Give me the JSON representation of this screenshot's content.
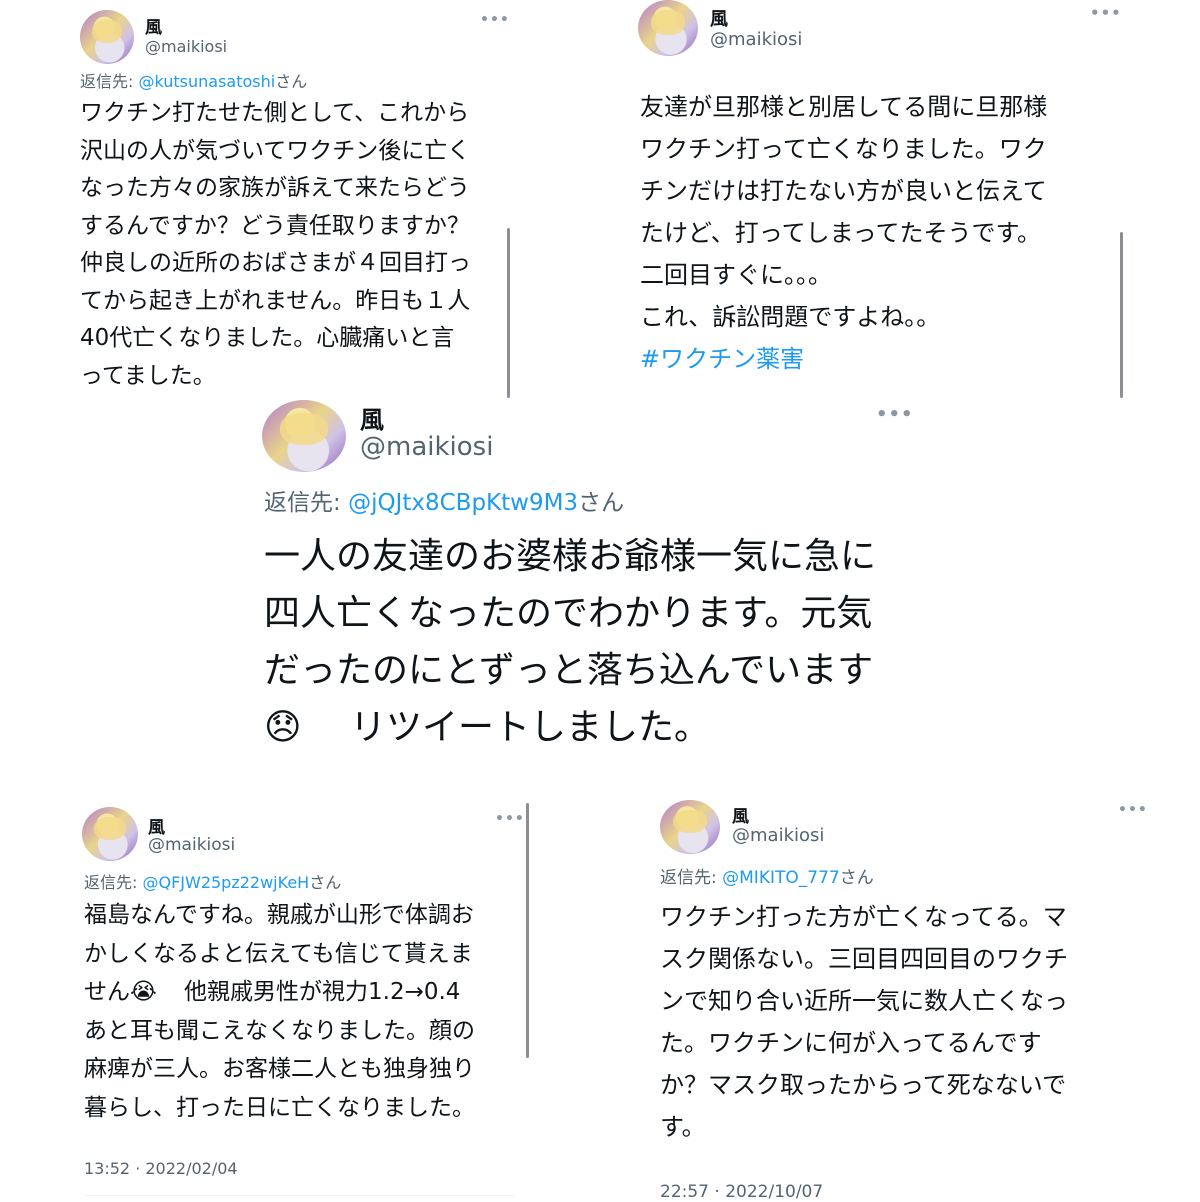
{
  "tweets": [
    {
      "name": "風",
      "handle": "@maikiosi",
      "more_icon": "more-dots-icon",
      "reply_prefix": "返信先: ",
      "reply_mention": "@kutsunasatoshi",
      "reply_suffix": "さん",
      "lines": [
        "ワクチン打たせた側として、これから",
        "沢山の人が気づいてワクチン後に亡く",
        "なった方々の家族が訴えて来たらどう",
        "するんですか？どう責任取りますか？",
        "仲良しの近所のおばさまが４回目打っ",
        "てから起き上がれません。昨日も１人",
        "40代亡くなりました。心臓痛いと言",
        "ってました。"
      ]
    },
    {
      "name": "風",
      "handle": "@maikiosi",
      "more_icon": "more-dots-icon",
      "lines": [
        "友達が旦那様と別居してる間に旦那様",
        "ワクチン打って亡くなりました。ワク",
        "チンだけは打たない方が良いと伝えて",
        "たけど、打ってしまってたそうです。",
        "二回目すぐに。。。",
        "これ、訴訟問題ですよね。。"
      ],
      "hashtag": "#ワクチン薬害"
    },
    {
      "name": "風",
      "handle": "@maikiosi",
      "more_icon": "more-dots-icon",
      "reply_prefix": "返信先: ",
      "reply_mention": "@jQJtx8CBpKtw9M3",
      "reply_suffix": "さん",
      "lines": [
        "一人の友達のお婆様お爺様一気に急に",
        "四人亡くなったのでわかります。元気",
        "だったのにとずっと落ち込んでいます"
      ],
      "emoji": "😞",
      "last_line": "リツイートしました。"
    },
    {
      "name": "風",
      "handle": "@maikiosi",
      "more_icon": "more-dots-icon",
      "reply_prefix": "返信先: ",
      "reply_mention": "@QFJW25pz22wjKeH",
      "reply_suffix": "さん",
      "lines": [
        "福島なんですね。親戚が山形で体調お",
        "かしくなるよと伝えても信じて貰えま"
      ],
      "line3_start": "せん",
      "emoji": "😭",
      "line3_end": "他親戚男性が視力1.2→0.4",
      "lines_after": [
        "あと耳も聞こえなくなりました。顔の",
        "麻痺が三人。お客様二人とも独身独り",
        "暮らし、打った日に亡くなりました。"
      ],
      "timestamp": "13:52 · 2022/02/04"
    },
    {
      "name": "風",
      "handle": "@maikiosi",
      "more_icon": "more-dots-icon",
      "reply_prefix": "返信先: ",
      "reply_mention": "@MIKITO_777",
      "reply_suffix": "さん",
      "lines": [
        "ワクチン打った方が亡くなってる。マ",
        "スク関係ない。三回目四回目のワクチ",
        "ンで知り合い近所一気に数人亡くなっ",
        "た。ワクチンに何が入ってるんです",
        "か？マスク取ったからって死なないで",
        "す。"
      ],
      "timestamp": "22:57 · 2022/10/07"
    }
  ]
}
